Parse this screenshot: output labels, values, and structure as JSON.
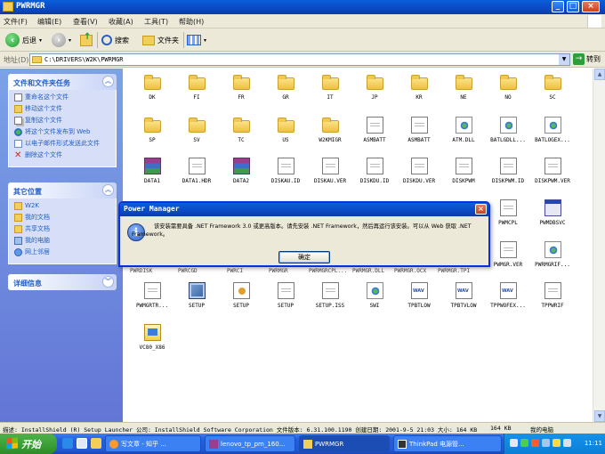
{
  "window": {
    "title": "PWRMGR",
    "controls": {
      "minimize": "_",
      "maximize": "□",
      "close": "×"
    },
    "icon": "folder-icon"
  },
  "menu": [
    "文件(F)",
    "编辑(E)",
    "查看(V)",
    "收藏(A)",
    "工具(T)",
    "帮助(H)"
  ],
  "toolbar": {
    "back": "后退",
    "search": "搜索",
    "folders": "文件夹"
  },
  "address": {
    "label": "地址(D)",
    "path": "C:\\DRIVERS\\W2K\\PWRMGR",
    "go": "转到"
  },
  "sidebar": {
    "file_tasks": {
      "title": "文件和文件夹任务",
      "items": [
        {
          "label": "重命名这个文件",
          "icon": "rename-icon"
        },
        {
          "label": "移动这个文件",
          "icon": "move-icon"
        },
        {
          "label": "复制这个文件",
          "icon": "copy-icon"
        },
        {
          "label": "将这个文件发布到 Web",
          "icon": "globe-icon"
        },
        {
          "label": "以电子邮件形式发送此文件",
          "icon": "email-icon"
        },
        {
          "label": "删除这个文件",
          "icon": "delete-icon"
        }
      ]
    },
    "other_places": {
      "title": "其它位置",
      "items": [
        {
          "label": "W2K",
          "icon": "folder-icon"
        },
        {
          "label": "我的文档",
          "icon": "my-documents-icon"
        },
        {
          "label": "共享文档",
          "icon": "shared-documents-icon"
        },
        {
          "label": "我的电脑",
          "icon": "my-computer-icon"
        },
        {
          "label": "网上邻居",
          "icon": "network-icon"
        }
      ]
    },
    "details": {
      "title": "详细信息"
    }
  },
  "files": [
    {
      "name": "DK",
      "type": "folder"
    },
    {
      "name": "FI",
      "type": "folder"
    },
    {
      "name": "FR",
      "type": "folder"
    },
    {
      "name": "GR",
      "type": "folder"
    },
    {
      "name": "IT",
      "type": "folder"
    },
    {
      "name": "JP",
      "type": "folder"
    },
    {
      "name": "KR",
      "type": "folder"
    },
    {
      "name": "NE",
      "type": "folder"
    },
    {
      "name": "NO",
      "type": "folder"
    },
    {
      "name": "SC",
      "type": "folder"
    },
    {
      "name": "SP",
      "type": "folder"
    },
    {
      "name": "SV",
      "type": "folder"
    },
    {
      "name": "TC",
      "type": "folder"
    },
    {
      "name": "US",
      "type": "folder"
    },
    {
      "name": "W2KMIGR",
      "type": "folder"
    },
    {
      "name": "ASMBATT",
      "type": "doc"
    },
    {
      "name": "ASMBATT",
      "type": "doc"
    },
    {
      "name": "ATM.DLL",
      "type": "dll"
    },
    {
      "name": "BATLGDLL...",
      "type": "dll"
    },
    {
      "name": "BATLOGEX...",
      "type": "dll"
    },
    {
      "name": "DATA1",
      "type": "rar"
    },
    {
      "name": "DATA1.HDR",
      "type": "doc"
    },
    {
      "name": "DATA2",
      "type": "rar"
    },
    {
      "name": "DISKAU.ID",
      "type": "doc"
    },
    {
      "name": "DISKAU.VER",
      "type": "doc"
    },
    {
      "name": "DISKDU.ID",
      "type": "doc"
    },
    {
      "name": "DISKDU.VER",
      "type": "doc"
    },
    {
      "name": "DISKPWM",
      "type": "doc"
    },
    {
      "name": "DISKPWM.ID",
      "type": "doc"
    },
    {
      "name": "DISKPWM.VER",
      "type": "doc"
    },
    {
      "name": "PWMCPL",
      "type": "doc"
    },
    {
      "name": "PWMDBSVC",
      "type": "exe"
    },
    {
      "name": "PWMGR.VER",
      "type": "doc"
    },
    {
      "name": "PWRMGRIF...",
      "type": "dll"
    },
    {
      "name": "PWMGRTR...",
      "type": "doc"
    },
    {
      "name": "SETUP",
      "type": "setup"
    },
    {
      "name": "SETUP",
      "type": "ini"
    },
    {
      "name": "SETUP",
      "type": "doc"
    },
    {
      "name": "SETUP.ISS",
      "type": "doc"
    },
    {
      "name": "SWI",
      "type": "dll"
    },
    {
      "name": "TPBTLOW",
      "type": "wav"
    },
    {
      "name": "TPBTVLOW",
      "type": "wav"
    },
    {
      "name": "TPPWOFEX...",
      "type": "wav"
    },
    {
      "name": "TPPWRIF",
      "type": "doc"
    },
    {
      "name": "VC80_X86",
      "type": "vc"
    }
  ],
  "partial_labels": [
    "PWRDISK",
    "PWRCGD",
    "PWRCI",
    "PWRMGR",
    "PWRMGRCPL...",
    "PWRMGR.DLL",
    "PWRMGR.OCX",
    "PWRMGR.TPI"
  ],
  "dialog": {
    "title": "Power Manager",
    "message": "该安装需要具备 .NET Framework 3.0 或更高版本。请先安装 .NET Framework，然后再运行该安装。可以从 Web 获取 .NET Framework。",
    "ok": "确定"
  },
  "status": {
    "text": "描述: InstallShield (R) Setup Launcher 公司: InstallShield Software Corporation 文件版本: 6.31.100.1190 创建日期: 2001-9-5 21:03 大小: 164 KB",
    "size": "164 KB",
    "zone": "我的电脑"
  },
  "taskbar": {
    "start": "开始",
    "buttons": [
      "写文章 - 知乎 ...",
      "lenovo_tp_pm_160...",
      "PWRMGR",
      "ThinkPad 电源管..."
    ],
    "clock": "11:11"
  },
  "colors": {
    "xp_blue": "#0a5fd8",
    "taskbar": "#245edc",
    "start_green": "#3a9d35",
    "sidebar": "#7ba2e7"
  }
}
